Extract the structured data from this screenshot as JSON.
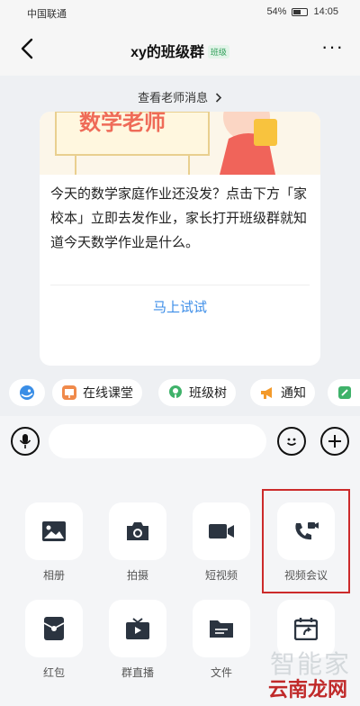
{
  "status_bar": {
    "carrier": "中国联通",
    "battery": "54%",
    "time": "14:05"
  },
  "header": {
    "title": "xy的班级群",
    "badge": "班级",
    "more": "···"
  },
  "chat": {
    "teacher_link": "查看老师消息",
    "card": {
      "illustration_text": "数学老师",
      "text": "今天的数学家庭作业还没发？点击下方「家校本」立即去发作业，家长打开班级群就知道今天数学作业是什么。",
      "action": "马上试试"
    }
  },
  "shortcuts": [
    {
      "label": "在线课堂"
    },
    {
      "label": "班级树"
    },
    {
      "label": "通知"
    }
  ],
  "panel": {
    "tiles": [
      {
        "label": "相册",
        "icon": "image-icon"
      },
      {
        "label": "拍摄",
        "icon": "camera-icon"
      },
      {
        "label": "短视频",
        "icon": "video-icon"
      },
      {
        "label": "视频会议",
        "icon": "video-call-icon"
      },
      {
        "label": "红包",
        "icon": "red-packet-icon"
      },
      {
        "label": "群直播",
        "icon": "live-tv-icon"
      },
      {
        "label": "文件",
        "icon": "folder-icon"
      },
      {
        "label": "",
        "icon": "calendar-icon"
      }
    ]
  },
  "watermark": {
    "text": "智能家",
    "brand": "云南龙网"
  },
  "colors": {
    "accent": "#3d8ee8",
    "badge_green": "#2f9e58",
    "highlight": "#cc2b2b"
  }
}
